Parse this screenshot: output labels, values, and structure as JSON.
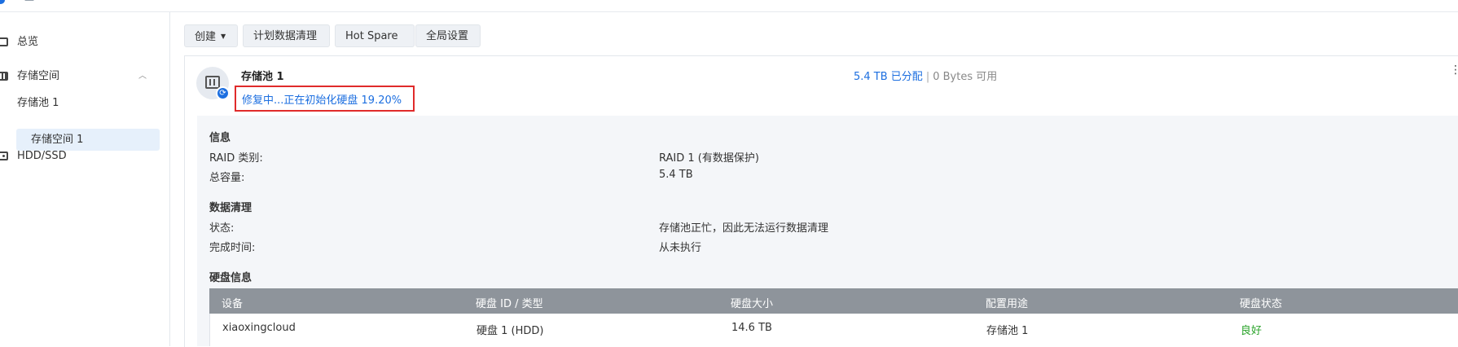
{
  "topbar": {
    "title_glyph": "—"
  },
  "sidebar": {
    "overview": "总览",
    "storage_space": "存储空间",
    "pool": "存储池 1",
    "space": "存储空间 1",
    "hdd": "HDD/SSD"
  },
  "toolbar": {
    "create": "创建",
    "scrub_schedule": "计划数据清理",
    "hot_spare": "Hot Spare",
    "global_settings": "全局设置"
  },
  "pool": {
    "title": "存储池 1",
    "status": "修复中...正在初始化硬盘 19.20%",
    "allocated": "5.4 TB 已分配",
    "separator": "|",
    "available": "0 Bytes 可用"
  },
  "info": {
    "title": "信息",
    "raid_label": "RAID 类别:",
    "raid_value": "RAID 1 (有数据保护)",
    "capacity_label": "总容量:",
    "capacity_value": "5.4 TB"
  },
  "scrub": {
    "title": "数据清理",
    "status_label": "状态:",
    "status_value": "存储池正忙，因此无法运行数据清理",
    "finish_label": "完成时间:",
    "finish_value": "从未执行"
  },
  "disk_info": {
    "title": "硬盘信息",
    "columns": [
      "设备",
      "硬盘 ID / 类型",
      "硬盘大小",
      "配置用途",
      "硬盘状态"
    ],
    "rows": [
      [
        "xiaoxingcloud",
        "硬盘 1 (HDD)",
        "14.6 TB",
        "存储池 1",
        "良好"
      ]
    ]
  },
  "colors": {
    "accent": "#1d6fe0",
    "highlight_border": "#e02b2b",
    "good": "#2aa32a",
    "table_header": "#8e949b"
  }
}
